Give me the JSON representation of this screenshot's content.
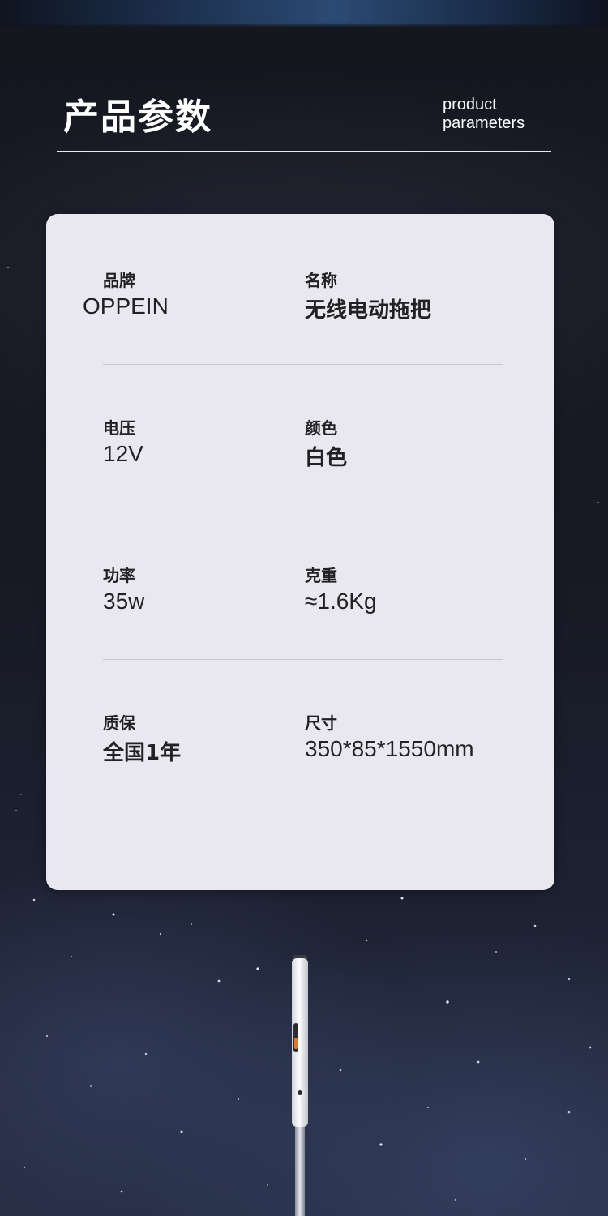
{
  "header": {
    "title_cn": "产品参数",
    "title_en_line1": "product",
    "title_en_line2": "parameters"
  },
  "specs": [
    {
      "left": {
        "label": "品牌",
        "value": "OPPEIN"
      },
      "right": {
        "label": "名称",
        "value": "无线电动拖把"
      }
    },
    {
      "left": {
        "label": "电压",
        "value": "12V"
      },
      "right": {
        "label": "颜色",
        "value": "白色"
      }
    },
    {
      "left": {
        "label": "功率",
        "value": "35w"
      },
      "right": {
        "label": "克重",
        "value": "≈1.6Kg"
      }
    },
    {
      "left": {
        "label": "质保",
        "value": "全国1年"
      },
      "right": {
        "label": "尺寸",
        "value": "350*85*1550mm"
      }
    }
  ],
  "colors": {
    "background": "#12141d",
    "card": "#e9e8ee",
    "text_dark": "#222226",
    "text_light": "#ffffff",
    "divider": "#c9c8cf"
  }
}
